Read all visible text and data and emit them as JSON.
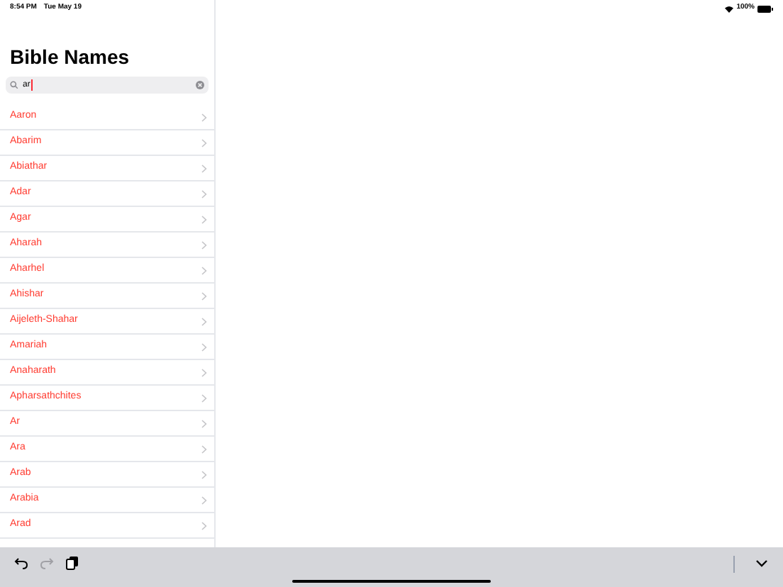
{
  "status_bar": {
    "time": "8:54 PM",
    "date": "Tue May 19",
    "battery": "100%"
  },
  "title": "Bible Names",
  "search": {
    "value": "ar"
  },
  "names": [
    "Aaron",
    "Abarim",
    "Abiathar",
    "Adar",
    "Agar",
    "Aharah",
    "Aharhel",
    "Ahishar",
    "Aijeleth-Shahar",
    "Amariah",
    "Anaharath",
    "Apharsathchites",
    "Ar",
    "Ara",
    "Arab",
    "Arabia",
    "Arad"
  ],
  "keyboard_toolbar": {
    "undo": {
      "disabled": false
    },
    "redo": {
      "disabled": true
    }
  }
}
